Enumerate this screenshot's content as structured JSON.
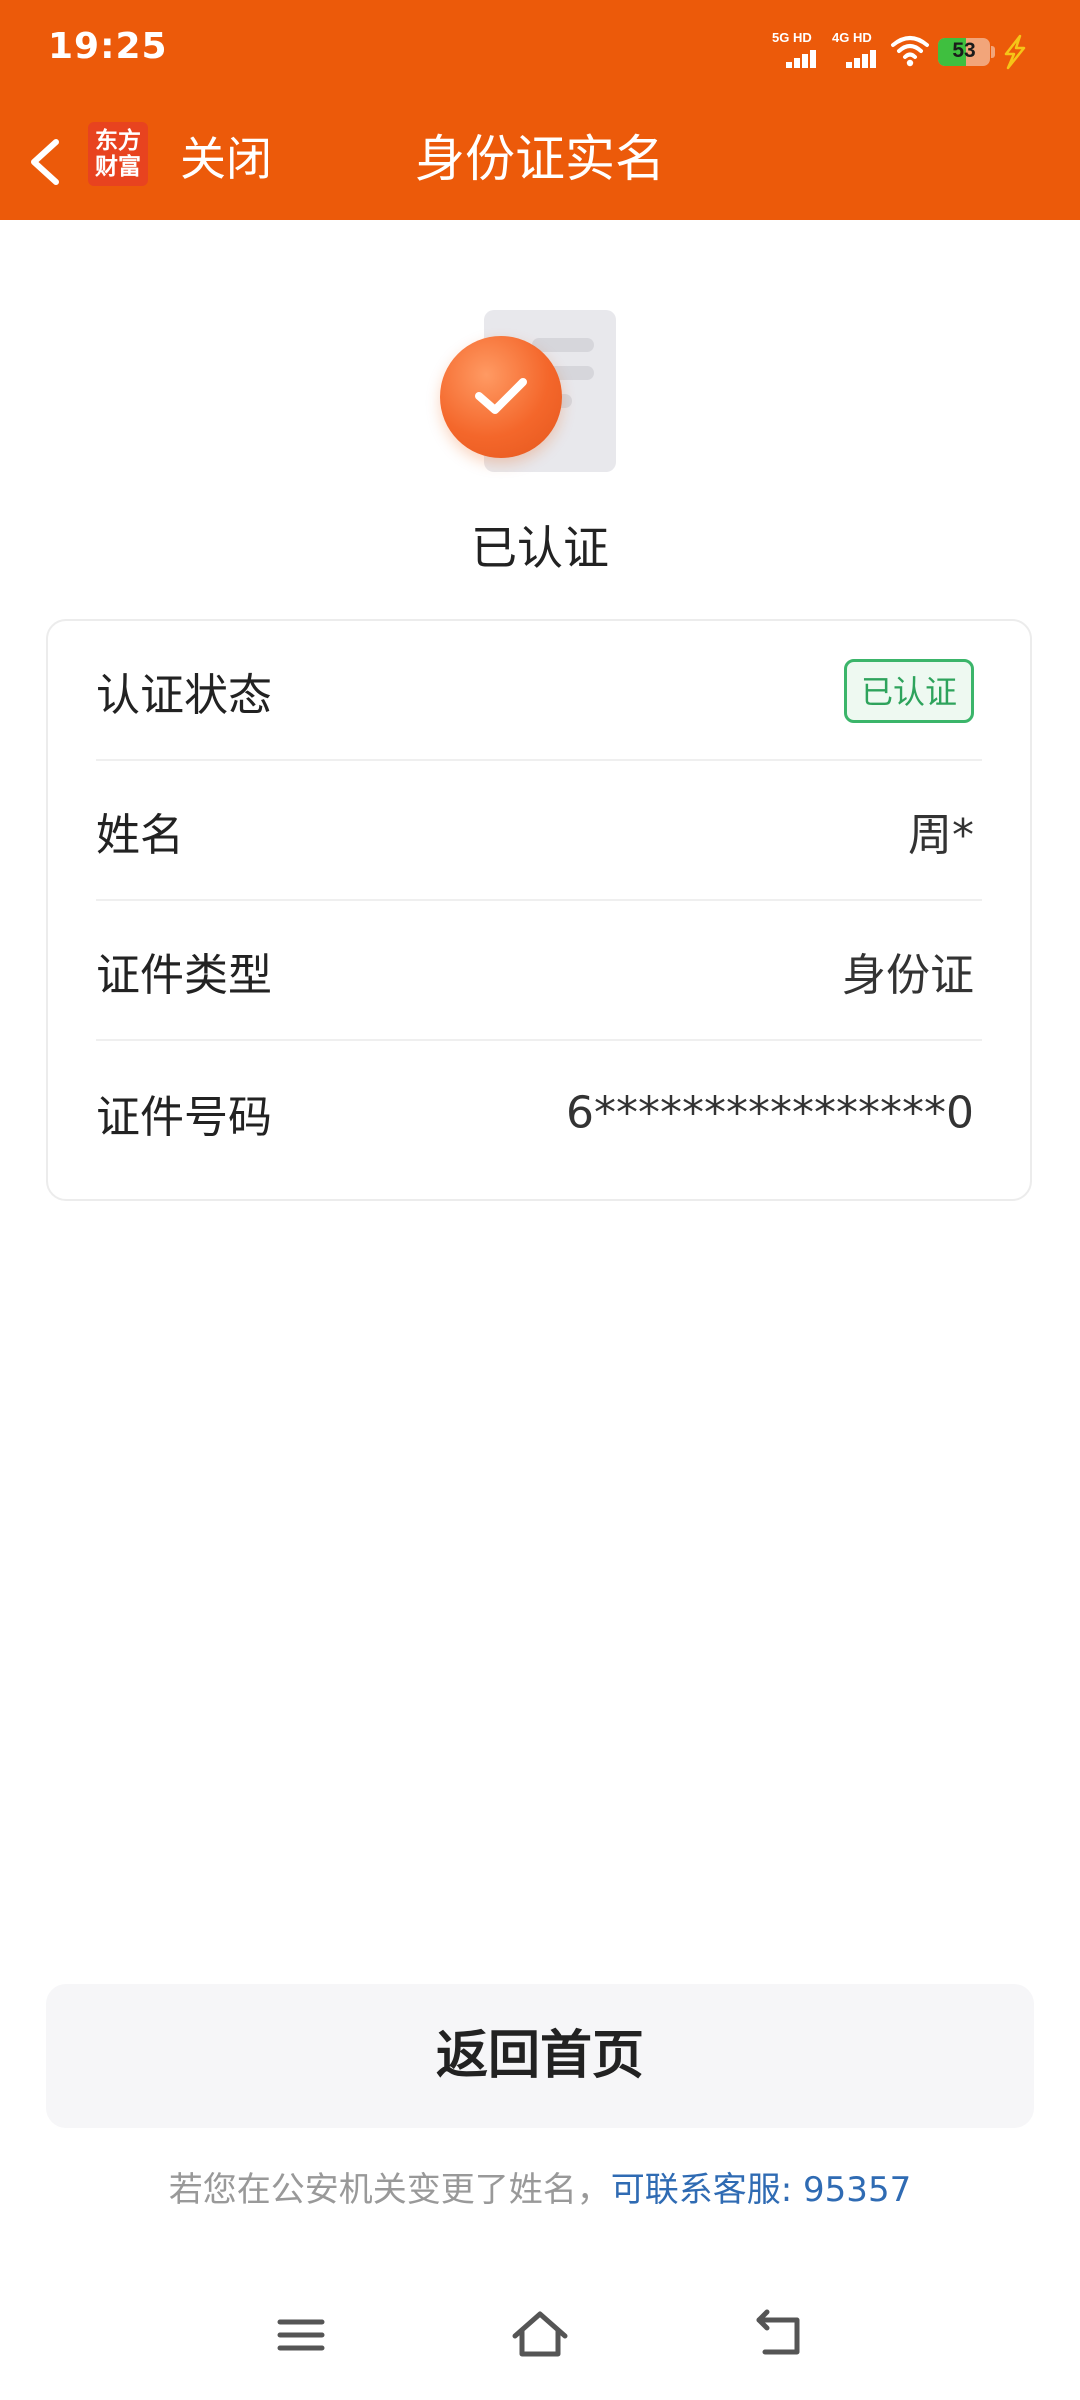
{
  "status_bar": {
    "time": "19:25",
    "signal_1_label": "5G HD",
    "signal_2_label": "4G HD",
    "wifi_icon": "wifi-icon",
    "battery_level": "53",
    "battery_fraction": 0.53,
    "charging_icon": "lightning-icon"
  },
  "header": {
    "back_icon": "chevron-left-icon",
    "logo_line1": "东方",
    "logo_line2": "财富",
    "close_label": "关闭",
    "title": "身份证实名"
  },
  "hero": {
    "icon": "verified-document-icon",
    "status": "已认证"
  },
  "info": {
    "rows": [
      {
        "label": "认证状态",
        "badge": "已认证"
      },
      {
        "label": "姓名",
        "value": "周*"
      },
      {
        "label": "证件类型",
        "value": "身份证"
      },
      {
        "label": "证件号码",
        "value": "6****************0"
      }
    ]
  },
  "actions": {
    "home_button_label": "返回首页"
  },
  "footer": {
    "note_text": "若您在公安机关变更了姓名，",
    "support_link": "可联系客服: 95357"
  },
  "nav_bar": {
    "menu_icon": "menu-icon",
    "home_icon": "home-icon",
    "back_icon": "back-icon"
  },
  "colors": {
    "brand": "#ec5a0a",
    "verified_green": "#3bb56a",
    "link_blue": "#2f6bb3"
  }
}
